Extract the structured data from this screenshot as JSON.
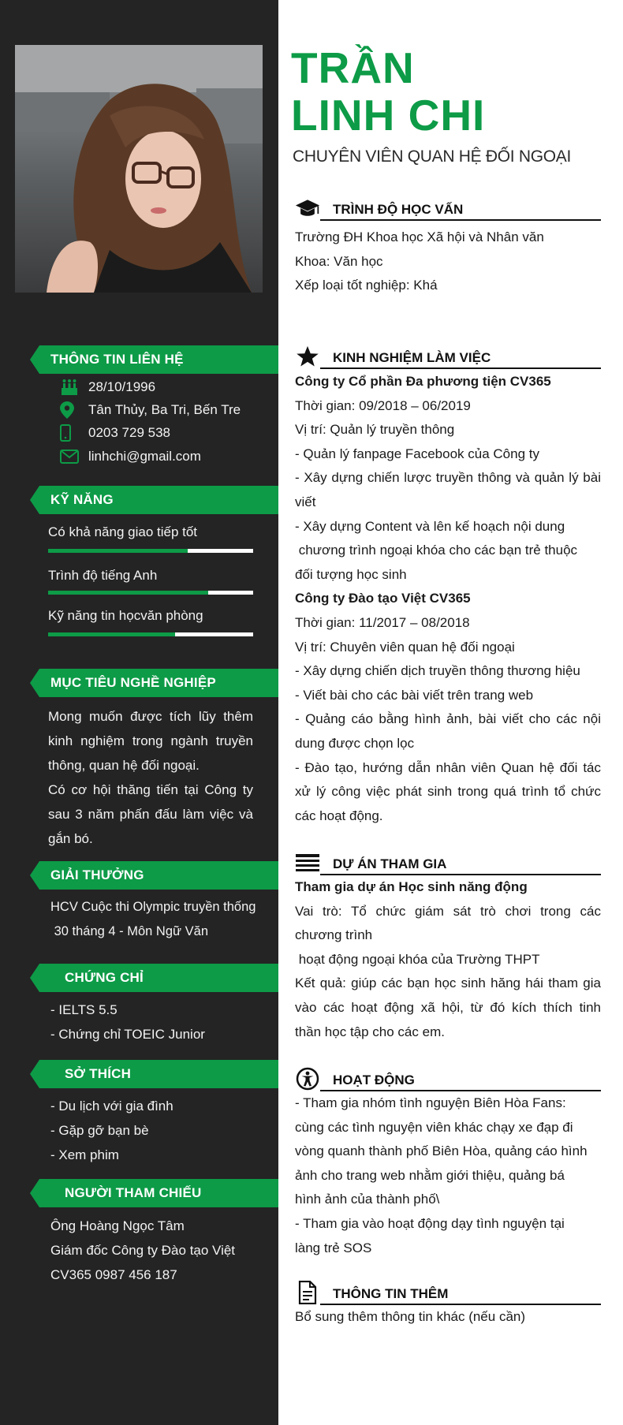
{
  "profile": {
    "name_line1": "TRẦN",
    "name_line2": "LINH CHI",
    "job_title": "CHUYÊN VIÊN QUAN HỆ ĐỐI NGOẠI"
  },
  "colors": {
    "accent": "#0d9b47",
    "sidebar": "#242424",
    "bar_track": "#ffffff"
  },
  "contact": {
    "title": "THÔNG TIN LIÊN HỆ",
    "items": [
      {
        "icon": "birthday-cake-icon",
        "text": "28/10/1996"
      },
      {
        "icon": "location-pin-icon",
        "text": "Tân Thủy, Ba Tri, Bến Tre"
      },
      {
        "icon": "mobile-phone-icon",
        "text": "0203 729 538"
      },
      {
        "icon": "email-icon",
        "text": "linhchi@gmail.com"
      }
    ]
  },
  "skills": {
    "title": "KỸ NĂNG",
    "items": [
      {
        "label": "Có khả năng giao tiếp tốt",
        "level": 0.68
      },
      {
        "label": "Trình độ tiếng Anh",
        "level": 0.78
      },
      {
        "label": "Kỹ năng tin họcvăn phòng",
        "level": 0.62
      }
    ]
  },
  "objective": {
    "title": "MỤC TIÊU NGHỀ NGHIỆP",
    "lines": [
      "Mong muốn được tích lũy thêm",
      "kinh nghiệm trong ngành truyền",
      "thông, quan hệ đối ngoại.",
      "Có cơ hội thăng tiến tại Công ty",
      "sau 3 năm phấn đấu làm việc và",
      "gắn bó."
    ]
  },
  "awards": {
    "title": "GIẢI THƯỞNG",
    "lines": [
      "HCV Cuộc thi Olympic truyền thống",
      " 30 tháng 4 - Môn Ngữ Văn"
    ]
  },
  "certificates": {
    "title": "CHỨNG CHỈ",
    "lines": [
      "- IELTS 5.5",
      "- Chứng chỉ TOEIC Junior"
    ]
  },
  "hobbies": {
    "title": "SỞ THÍCH",
    "lines": [
      "- Du lịch với gia đình",
      "- Gặp gỡ bạn bè",
      "- Xem phim"
    ]
  },
  "references": {
    "title": "NGƯỜI THAM CHIẾU",
    "lines": [
      "Ông Hoàng Ngọc Tâm",
      "Giám đốc Công ty Đào tạo Việt",
      "CV365 0987 456 187"
    ]
  },
  "education": {
    "title": "TRÌNH ĐỘ HỌC VẤN",
    "icon": "graduation-cap-icon",
    "lines": [
      "Trường ĐH Khoa học Xã hội và Nhân văn",
      "Khoa: Văn học",
      "Xếp loại tốt nghiệp: Khá"
    ]
  },
  "experience": {
    "title": "KINH NGHIỆM LÀM VIỆC",
    "icon": "star-icon",
    "lines": [
      {
        "text": "Công ty Cổ phần Đa phương tiện CV365",
        "style": "bold"
      },
      {
        "text": "Thời gian: 09/2018 – 06/2019",
        "style": ""
      },
      {
        "text": "Vị trí: Quản lý truyền thông",
        "style": ""
      },
      {
        "text": "- Quản lý fanpage Facebook của Công ty",
        "style": ""
      },
      {
        "text": "- Xây dựng chiến lược truyền thông và quản lý bài",
        "style": "just"
      },
      {
        "text": "viết",
        "style": ""
      },
      {
        "text": "- Xây dựng Content và lên kế hoạch nội dung",
        "style": ""
      },
      {
        "text": " chương trình ngoại khóa cho các bạn trẻ thuộc",
        "style": ""
      },
      {
        "text": "đối tượng học sinh",
        "style": ""
      },
      {
        "text": "Công ty Đào tạo Việt CV365",
        "style": "bold"
      },
      {
        "text": "Thời gian: 11/2017 – 08/2018",
        "style": ""
      },
      {
        "text": "Vị trí: Chuyên viên quan hệ đối ngoại",
        "style": ""
      },
      {
        "text": "- Xây dựng chiến dịch truyền thông thương hiệu",
        "style": ""
      },
      {
        "text": "- Viết bài cho các bài viết trên trang web",
        "style": ""
      },
      {
        "text": "- Quảng cáo bằng hình ảnh, bài viết cho các nội",
        "style": "just"
      },
      {
        "text": "dung được chọn lọc",
        "style": ""
      },
      {
        "text": "- Đào tạo, hướng dẫn nhân viên Quan hệ đối tác",
        "style": "just"
      },
      {
        "text": "xử lý công việc phát sinh trong quá trình tổ chức",
        "style": "just"
      },
      {
        "text": "các hoạt động.",
        "style": ""
      }
    ]
  },
  "projects": {
    "title": "DỰ ÁN THAM GIA",
    "icon": "list-lines-icon",
    "lines": [
      {
        "text": "Tham gia dự án Học sinh năng động",
        "style": "bold"
      },
      {
        "text": "Vai trò: Tổ chức giám sát trò chơi trong các",
        "style": "just"
      },
      {
        "text": "chương trình",
        "style": ""
      },
      {
        "text": " hoạt động ngoại khóa của Trường THPT",
        "style": ""
      },
      {
        "text": "Kết quả: giúp các bạn học sinh hăng hái tham gia",
        "style": "just"
      },
      {
        "text": "vào các hoạt động xã hội, từ đó kích thích tinh",
        "style": "just"
      },
      {
        "text": "thần học tập cho các em.",
        "style": ""
      }
    ]
  },
  "activities": {
    "title": "HOẠT ĐỘNG",
    "icon": "accessibility-person-icon",
    "lines": [
      {
        "text": "- Tham gia nhóm tình nguyện Biên Hòa Fans:",
        "style": ""
      },
      {
        "text": "cùng các tình nguyện viên khác chạy xe đạp đi",
        "style": ""
      },
      {
        "text": "vòng quanh thành phố Biên Hòa, quảng cáo hình",
        "style": ""
      },
      {
        "text": "ảnh cho trang web nhằm giới thiệu, quảng bá",
        "style": ""
      },
      {
        "text": "hình ảnh của thành phố\\",
        "style": ""
      },
      {
        "text": "- Tham gia vào hoạt động dạy tình nguyện tại",
        "style": ""
      },
      {
        "text": "làng trẻ SOS",
        "style": ""
      }
    ]
  },
  "additional": {
    "title": "THÔNG TIN THÊM",
    "icon": "document-icon",
    "lines": [
      {
        "text": "Bổ sung thêm thông tin khác (nếu cần)",
        "style": ""
      }
    ]
  }
}
